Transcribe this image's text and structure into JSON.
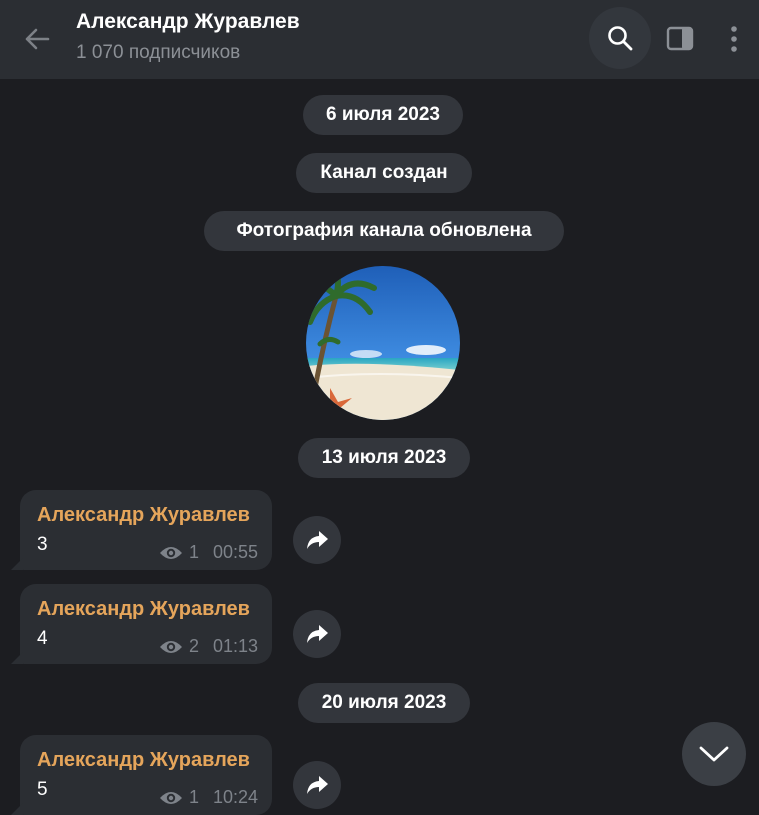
{
  "header": {
    "title": "Александр Журавлев",
    "subtitle": "1 070 подписчиков",
    "icons": [
      "back-arrow-icon",
      "search-icon",
      "sidebar-toggle-icon",
      "more-vert-icon"
    ]
  },
  "service": {
    "date1": "6 июля 2023",
    "channel_created": "Канал создан",
    "photo_updated": "Фотография канала обновлена",
    "date2": "13 июля 2023",
    "date3": "20 июля 2023"
  },
  "messages": [
    {
      "author": "Александр Журавлев",
      "text": "3",
      "views": "1",
      "time": "00:55"
    },
    {
      "author": "Александр Журавлев",
      "text": "4",
      "views": "2",
      "time": "01:13"
    },
    {
      "author": "Александр Журавлев",
      "text": "5",
      "views": "1",
      "time": "10:24"
    }
  ],
  "colors": {
    "background": "#1c1d21",
    "header": "#2b2e33",
    "bubble": "#2b2e33",
    "author_accent": "#e5a55b",
    "meta_text": "#7e838a"
  }
}
